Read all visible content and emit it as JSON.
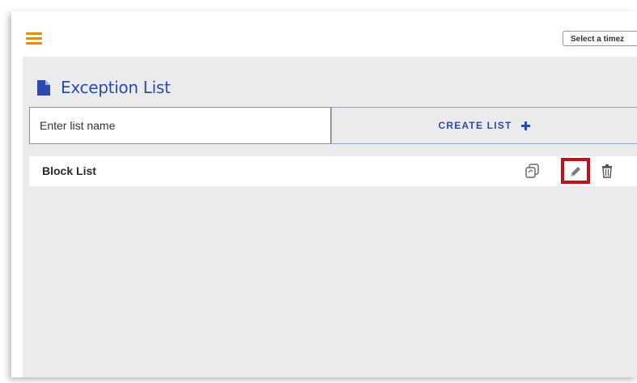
{
  "header": {
    "menu_icon": "hamburger-menu-icon",
    "timezone_select_value": "Select a timez"
  },
  "page": {
    "title_icon": "document-icon",
    "title": "Exception List"
  },
  "create_form": {
    "input_placeholder": "Enter list name",
    "create_button_label": "CREATE LIST",
    "create_button_icon": "plus-icon"
  },
  "lists": [
    {
      "name": "Block List",
      "actions": [
        "copy-icon",
        "edit-icon",
        "delete-icon"
      ]
    }
  ],
  "colors": {
    "accent_blue": "#2a4bb3",
    "menu_orange": "#d8901a",
    "highlight_red": "#c0111a",
    "content_background": "#ebebeb"
  }
}
